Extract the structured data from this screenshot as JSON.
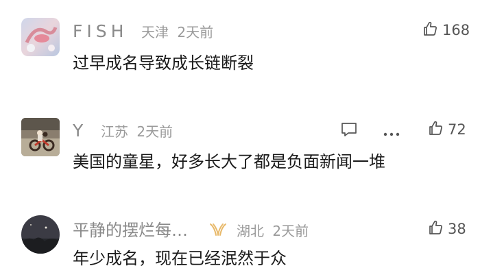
{
  "comments": [
    {
      "username": "FISH",
      "location": "天津",
      "time": "2天前",
      "text": "过早成名导致成长链断裂",
      "likes": "168"
    },
    {
      "username": "Y",
      "location": "江苏",
      "time": "2天前",
      "text": "美国的童星，好多长大了都是负面新闻一堆",
      "likes": "72"
    },
    {
      "username": "平静的摆烂每…",
      "location": "湖北",
      "time": "2天前",
      "text": "年少成名，现在已经泯然于众",
      "likes": "38"
    }
  ],
  "icons": {
    "like": "thumbs-up-icon",
    "reply": "comment-bubble-icon",
    "more": "more-dots-icon",
    "badge": "vip-badge-icon"
  },
  "colors": {
    "text": "#1a1a1a",
    "meta": "#9a9a9a",
    "badge": "#e8b96a"
  }
}
